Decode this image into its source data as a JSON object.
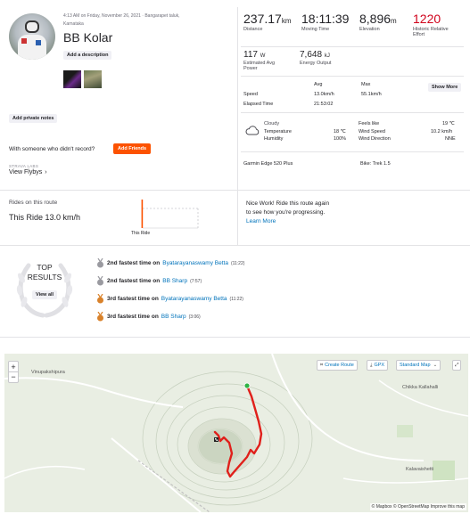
{
  "profile": {
    "date_line": "4:13 AM on Friday, November 26, 2021 · Bangarapet taluk,",
    "location_line": "Karnataka",
    "title": "BB Kolar",
    "add_description": "Add a description"
  },
  "stats": {
    "distance": {
      "value": "237.17",
      "unit": "km",
      "label": "Distance"
    },
    "moving_time": {
      "value": "18:11:39",
      "label": "Moving Time"
    },
    "elevation": {
      "value": "8,896",
      "unit": "m",
      "label": "Elevation"
    },
    "relative_effort": {
      "value": "1220",
      "label1": "Historic Relative",
      "label2": "Effort"
    },
    "power": {
      "value": "117",
      "unit": "W",
      "label1": "Estimated Avg",
      "label2": "Power"
    },
    "energy": {
      "value": "7,648",
      "unit": "kJ",
      "label": "Energy Output"
    }
  },
  "speed_table": {
    "avg_header": "Avg",
    "max_header": "Max",
    "show_more": "Show More",
    "speed_label": "Speed",
    "speed_avg": "13.0km/h",
    "speed_max": "55.1km/h",
    "elapsed_label": "Elapsed Time",
    "elapsed_value": "21:53:02"
  },
  "weather": {
    "condition": "Cloudy",
    "temp_label": "Temperature",
    "temp_value": "18 ℃",
    "humidity_label": "Humidity",
    "humidity_value": "100%",
    "feels_label": "Feels like",
    "feels_value": "19 ℃",
    "wind_speed_label": "Wind Speed",
    "wind_speed_value": "10.2 km/h",
    "wind_dir_label": "Wind Direction",
    "wind_dir_value": "NNE"
  },
  "device": {
    "device": "Garmin Edge 520 Plus",
    "bike": "Bike: Trek 1.5"
  },
  "notes": {
    "add_private_notes": "Add private notes",
    "with_someone": "With someone who didn't record?",
    "add_friends": "Add Friends",
    "strava_labs": "STRAVA LABS",
    "view_flybys": "View Flybys"
  },
  "route": {
    "rides_on_route": "Rides on this route",
    "this_ride": "This Ride 13.0 km/h",
    "chart_label": "This Ride",
    "nice_work": "Nice Work! Ride this route again",
    "progress_line": "to see how you're progressing.",
    "learn_more": "Learn More"
  },
  "top_results": {
    "title1": "TOP",
    "title2": "RESULTS",
    "view_all": "View all",
    "items": [
      {
        "rank": "2nd fastest time on",
        "segment": "Byatarayanaswamy Betta",
        "time": "(11:22)",
        "color": "#9a9aa0"
      },
      {
        "rank": "2nd fastest time on",
        "segment": "BB Sharp",
        "time": "(7:57)",
        "color": "#9a9aa0"
      },
      {
        "rank": "3rd fastest time on",
        "segment": "Byatarayanaswamy Betta",
        "time": "(11:22)",
        "color": "#d9822b"
      },
      {
        "rank": "3rd fastest time on",
        "segment": "BB Sharp",
        "time": "(3:06)",
        "color": "#d9822b"
      }
    ]
  },
  "map": {
    "zoom_in": "+",
    "zoom_out": "−",
    "create_route": "Create Route",
    "gpx": "GPX",
    "map_style": "Standard Map",
    "place_1": "Vinupakshipura",
    "place_2": "Chikka Kallahalli",
    "place_3": "Kalavaishetti",
    "attribution": "© Mapbox © OpenStreetMap Improve this map",
    "route_color": "#e0201b"
  },
  "colors": {
    "accent": "#fc5200",
    "relative_effort": "#d0021b",
    "link": "#0073bb"
  }
}
